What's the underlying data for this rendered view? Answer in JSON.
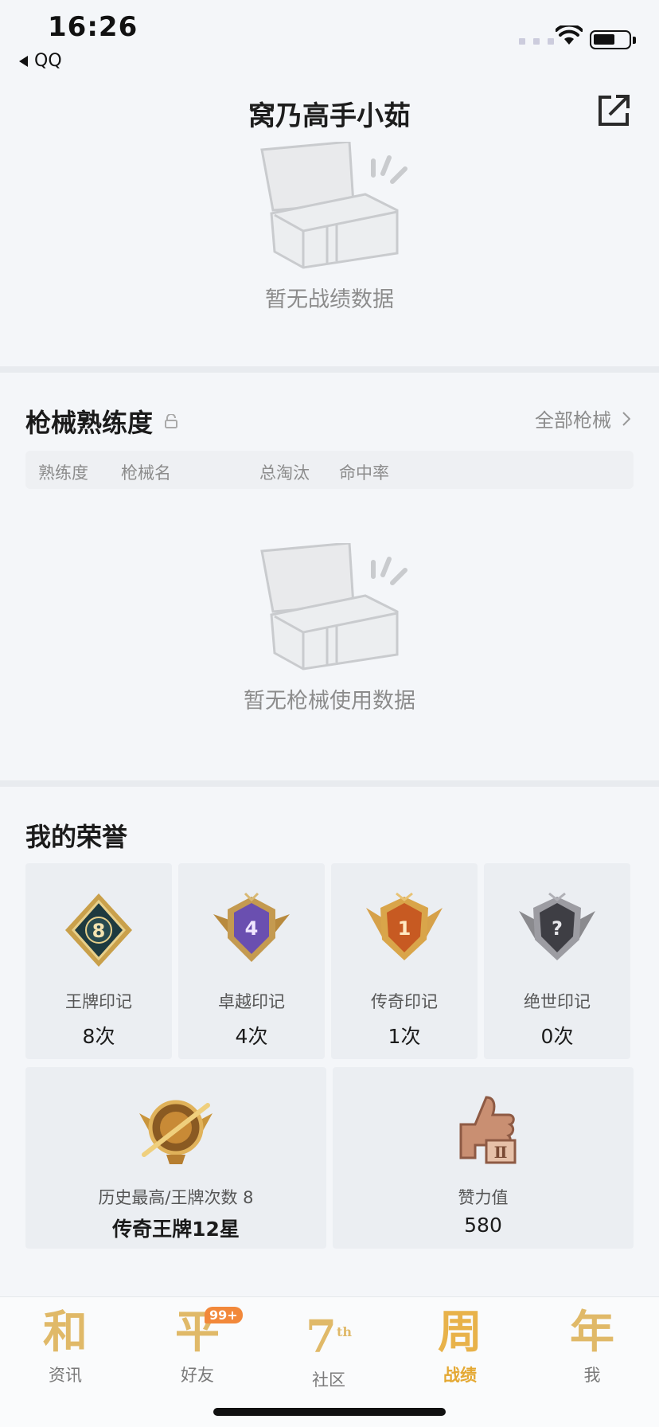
{
  "status_bar": {
    "time": "16:26",
    "back_app": "QQ"
  },
  "header": {
    "title": "窝乃高手小茹"
  },
  "record_empty": {
    "message": "暂无战绩数据"
  },
  "gun_section": {
    "title": "枪械熟练度",
    "all_link": "全部枪械",
    "columns": [
      "熟练度",
      "枪械名",
      "总淘汰",
      "命中率"
    ],
    "empty_message": "暂无枪械使用数据"
  },
  "honor_section": {
    "title": "我的荣誉",
    "badges": [
      {
        "name": "王牌印记",
        "count": "8次",
        "icon": "ace-mark-badge-icon",
        "mark": "8"
      },
      {
        "name": "卓越印记",
        "count": "4次",
        "icon": "excellence-mark-badge-icon",
        "mark": "4"
      },
      {
        "name": "传奇印记",
        "count": "1次",
        "icon": "legend-mark-badge-icon",
        "mark": "1"
      },
      {
        "name": "绝世印记",
        "count": "0次",
        "icon": "peerless-mark-badge-icon",
        "mark": "?"
      }
    ],
    "history": {
      "label": "历史最高/王牌次数 8",
      "value": "传奇王牌12星",
      "icon": "rank-emblem-icon"
    },
    "likes": {
      "label": "赞力值",
      "value": "580",
      "icon": "thumbs-up-icon",
      "sub": "Ⅱ"
    }
  },
  "tab_bar": {
    "tabs": [
      {
        "glyph": "和",
        "label": "资讯",
        "active": false
      },
      {
        "glyph": "平",
        "label": "好友",
        "active": false,
        "badge": "99+"
      },
      {
        "glyph": "7",
        "label": "社区",
        "active": false,
        "sub": "th"
      },
      {
        "glyph": "周",
        "label": "战绩",
        "active": true
      },
      {
        "glyph": "年",
        "label": "我",
        "active": false
      }
    ]
  },
  "colors": {
    "accent": "#e4a832",
    "badge": "#f2883a",
    "background": "#f4f6f9"
  }
}
